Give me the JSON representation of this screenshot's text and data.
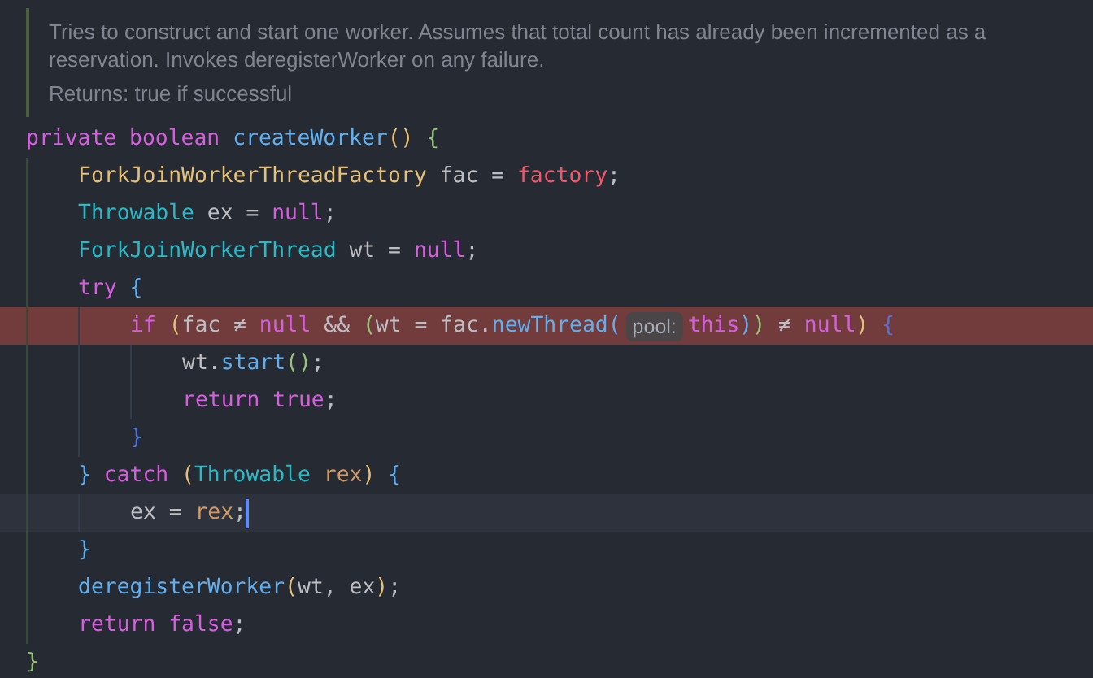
{
  "doc": {
    "text": "Tries to construct and start one worker. Assumes that total count has already been incremented as a reservation. Invokes deregisterWorker on any failure.",
    "returns_label": "Returns:",
    "returns_text": "true if successful"
  },
  "code": [
    {
      "breakpoint": false,
      "current": false,
      "tokens": [
        {
          "text": "private ",
          "kind": "keyword"
        },
        {
          "text": "boolean ",
          "kind": "keyword"
        },
        {
          "text": "createWorker",
          "kind": "function"
        },
        {
          "text": "() ",
          "kind": "bracket",
          "color": "#e5c07b"
        },
        {
          "text": "{",
          "kind": "bracket",
          "color": "#98c379"
        }
      ],
      "children": [
        {
          "breakpoint": false,
          "current": false,
          "tokens": [
            {
              "text": "ForkJoinWorkerThreadFactory",
              "kind": "interface"
            },
            {
              "text": " fac = ",
              "kind": "plain"
            },
            {
              "text": "factory",
              "kind": "field"
            },
            {
              "text": ";",
              "kind": "plain"
            }
          ]
        },
        {
          "breakpoint": false,
          "current": false,
          "tokens": [
            {
              "text": "Throwable",
              "kind": "class"
            },
            {
              "text": " ex = ",
              "kind": "plain"
            },
            {
              "text": "null",
              "kind": "keyword"
            },
            {
              "text": ";",
              "kind": "plain"
            }
          ]
        },
        {
          "breakpoint": false,
          "current": false,
          "tokens": [
            {
              "text": "ForkJoinWorkerThread",
              "kind": "class"
            },
            {
              "text": " wt = ",
              "kind": "plain"
            },
            {
              "text": "null",
              "kind": "keyword"
            },
            {
              "text": ";",
              "kind": "plain"
            }
          ]
        },
        {
          "breakpoint": false,
          "current": false,
          "tokens": [
            {
              "text": "try ",
              "kind": "keyword"
            },
            {
              "text": "{",
              "kind": "bracket",
              "color": "#61afef"
            }
          ],
          "children": [
            {
              "breakpoint": true,
              "current": false,
              "tokens": [
                {
                  "text": "if ",
                  "kind": "keyword"
                },
                {
                  "text": "(",
                  "kind": "bracket",
                  "color": "#e5c07b"
                },
                {
                  "text": "fac ≠ ",
                  "kind": "plain"
                },
                {
                  "text": "null",
                  "kind": "keyword"
                },
                {
                  "text": " && ",
                  "kind": "plain"
                },
                {
                  "text": "(",
                  "kind": "bracket",
                  "color": "#98c379"
                },
                {
                  "text": "wt = fac.",
                  "kind": "plain"
                },
                {
                  "text": "newThread",
                  "kind": "function"
                },
                {
                  "text": "(",
                  "kind": "bracket",
                  "color": "#61afef"
                },
                {
                  "text": "pool:",
                  "kind": "hint"
                },
                {
                  "text": "this",
                  "kind": "keyword"
                },
                {
                  "text": ")",
                  "kind": "bracket",
                  "color": "#61afef"
                },
                {
                  "text": ")",
                  "kind": "bracket",
                  "color": "#98c379"
                },
                {
                  "text": " ≠ ",
                  "kind": "plain"
                },
                {
                  "text": "null",
                  "kind": "keyword"
                },
                {
                  "text": ") ",
                  "kind": "bracket",
                  "color": "#e5c07b"
                },
                {
                  "text": "{",
                  "kind": "bracket",
                  "color": "#5472d3"
                }
              ],
              "children": [
                {
                  "breakpoint": false,
                  "current": false,
                  "tokens": [
                    {
                      "text": "wt.",
                      "kind": "plain"
                    },
                    {
                      "text": "start",
                      "kind": "function"
                    },
                    {
                      "text": "()",
                      "kind": "bracket",
                      "color": "#98c379"
                    },
                    {
                      "text": ";",
                      "kind": "plain"
                    }
                  ]
                },
                {
                  "breakpoint": false,
                  "current": false,
                  "tokens": [
                    {
                      "text": "return ",
                      "kind": "keyword"
                    },
                    {
                      "text": "true",
                      "kind": "keyword"
                    },
                    {
                      "text": ";",
                      "kind": "plain"
                    }
                  ]
                }
              ]
            },
            {
              "breakpoint": false,
              "current": false,
              "tokens": [
                {
                  "text": "}",
                  "kind": "bracket",
                  "color": "#5472d3"
                }
              ]
            }
          ]
        },
        {
          "breakpoint": false,
          "current": false,
          "tokens": [
            {
              "text": "} ",
              "kind": "bracket",
              "color": "#61afef"
            },
            {
              "text": "catch ",
              "kind": "keyword"
            },
            {
              "text": "(",
              "kind": "bracket",
              "color": "#e5c07b"
            },
            {
              "text": "Throwable ",
              "kind": "class"
            },
            {
              "text": "rex",
              "kind": "param"
            },
            {
              "text": ") ",
              "kind": "bracket",
              "color": "#e5c07b"
            },
            {
              "text": "{",
              "kind": "bracket",
              "color": "#61afef"
            }
          ],
          "children": [
            {
              "breakpoint": false,
              "current": true,
              "tokens": [
                {
                  "text": "ex = ",
                  "kind": "plain"
                },
                {
                  "text": "rex",
                  "kind": "param"
                },
                {
                  "text": ";",
                  "kind": "plain"
                }
              ]
            }
          ]
        },
        {
          "breakpoint": false,
          "current": false,
          "tokens": [
            {
              "text": "}",
              "kind": "bracket",
              "color": "#61afef"
            }
          ]
        },
        {
          "breakpoint": false,
          "current": false,
          "tokens": [
            {
              "text": "deregisterWorker",
              "kind": "function"
            },
            {
              "text": "(",
              "kind": "bracket",
              "color": "#e5c07b"
            },
            {
              "text": "wt, ex",
              "kind": "plain"
            },
            {
              "text": ")",
              "kind": "bracket",
              "color": "#e5c07b"
            },
            {
              "text": ";",
              "kind": "plain"
            }
          ]
        },
        {
          "breakpoint": false,
          "current": false,
          "tokens": [
            {
              "text": "return ",
              "kind": "keyword"
            },
            {
              "text": "false",
              "kind": "keyword"
            },
            {
              "text": ";",
              "kind": "plain"
            }
          ]
        }
      ]
    },
    {
      "breakpoint": false,
      "current": false,
      "tokens": [
        {
          "text": "}",
          "kind": "bracket",
          "color": "#98c379"
        }
      ]
    }
  ]
}
